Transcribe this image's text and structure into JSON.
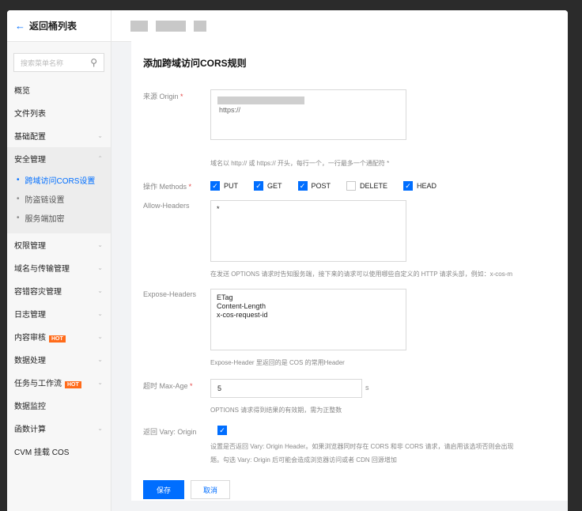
{
  "sidebar": {
    "back_label": "返回桶列表",
    "search_placeholder": "搜索菜单名称",
    "items": [
      {
        "label": "概览"
      },
      {
        "label": "文件列表"
      },
      {
        "label": "基础配置"
      },
      {
        "label": "安全管理"
      }
    ],
    "security_sub": [
      {
        "label": "跨域访问CORS设置",
        "active": true
      },
      {
        "label": "防盗链设置"
      },
      {
        "label": "服务端加密"
      }
    ],
    "items_after": [
      {
        "label": "权限管理"
      },
      {
        "label": "域名与传输管理"
      },
      {
        "label": "容错容灾管理"
      },
      {
        "label": "日志管理"
      },
      {
        "label": "内容审核",
        "badge": "HOT"
      },
      {
        "label": "数据处理"
      },
      {
        "label": "任务与工作流",
        "badge": "HOT"
      },
      {
        "label": "数据监控"
      },
      {
        "label": "函数计算"
      },
      {
        "label": "CVM 挂载 COS"
      }
    ]
  },
  "form": {
    "title": "添加跨域访问CORS规则",
    "origin_label": "来源 Origin",
    "origin_value": "https://",
    "origin_hint": "域名以 http:// 或 https:// 开头，每行一个，一行最多一个通配符 *",
    "methods_label": "操作 Methods",
    "methods": [
      {
        "label": "PUT",
        "checked": true
      },
      {
        "label": "GET",
        "checked": true
      },
      {
        "label": "POST",
        "checked": true
      },
      {
        "label": "DELETE",
        "checked": false
      },
      {
        "label": "HEAD",
        "checked": true
      }
    ],
    "allow_headers_label": "Allow-Headers",
    "allow_headers_value": "*",
    "allow_headers_hint": "在发送 OPTIONS 请求时告知服务端，接下来的请求可以使用哪些自定义的 HTTP 请求头部，例如：x-cos-m",
    "expose_headers_label": "Expose-Headers",
    "expose_headers_value": "ETag\nContent-Length\nx-cos-request-id",
    "expose_headers_hint": "Expose-Header 里返回的是 COS 的常用Header",
    "maxage_label": "超时 Max-Age",
    "maxage_value": "5",
    "maxage_unit": "s",
    "maxage_hint": "OPTIONS 请求得到结果的有效期，需为正整数",
    "vary_label": "返回 Vary: Origin",
    "vary_checked": true,
    "vary_hint_1": "设置是否返回 Vary: Origin Header。如果浏览器同时存在 CORS 和非 CORS 请求，请启用该选项否则会出现",
    "vary_hint_2": "题。勾选 Vary: Origin 后可能会造成浏览器访问或者 CDN 回源增加",
    "save_label": "保存",
    "cancel_label": "取消",
    "required_mark": "*",
    "check_mark": "✓"
  },
  "colors": {
    "accent": "#006eff",
    "hot": "#ff6b1a"
  }
}
